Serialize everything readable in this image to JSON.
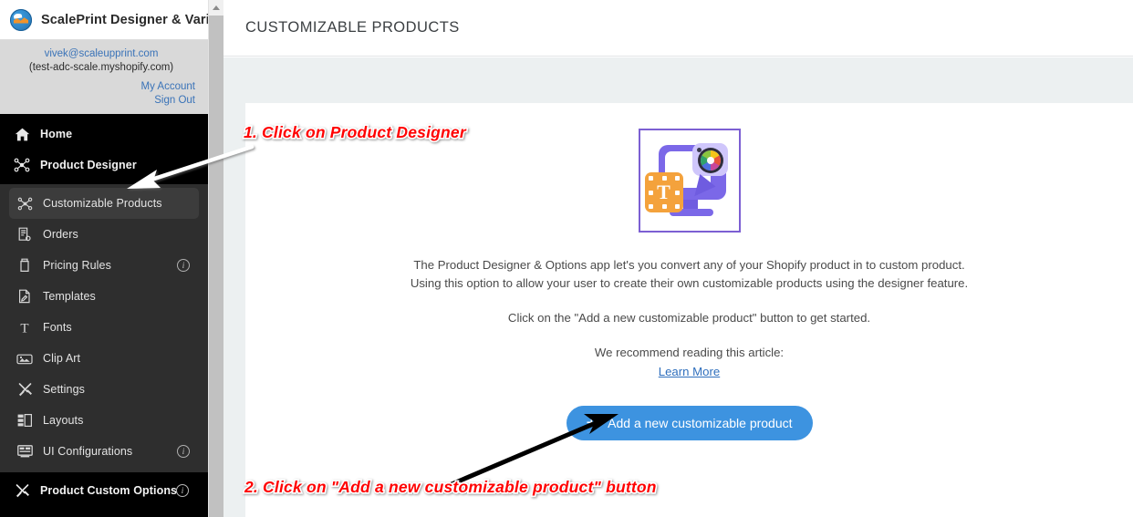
{
  "sidebar": {
    "brand": {
      "title": "ScalePrint Designer & Variants",
      "logo_icon": "scaleprint-logo-icon"
    },
    "account": {
      "email": "vivek@scaleupprint.com",
      "shop": "(test-adc-scale.myshopify.com)",
      "my_account": "My Account",
      "sign_out": "Sign Out"
    },
    "top_items": [
      {
        "label": "Home",
        "icon": "home-icon"
      },
      {
        "label": "Product Designer",
        "icon": "product-designer-icon"
      }
    ],
    "sub_items": [
      {
        "label": "Customizable Products",
        "icon": "product-designer-icon",
        "active": true,
        "info": false
      },
      {
        "label": "Orders",
        "icon": "orders-icon",
        "active": false,
        "info": false
      },
      {
        "label": "Pricing Rules",
        "icon": "pricing-icon",
        "active": false,
        "info": true
      },
      {
        "label": "Templates",
        "icon": "templates-icon",
        "active": false,
        "info": false
      },
      {
        "label": "Fonts",
        "icon": "fonts-icon",
        "active": false,
        "info": false
      },
      {
        "label": "Clip Art",
        "icon": "clipart-icon",
        "active": false,
        "info": false
      },
      {
        "label": "Settings",
        "icon": "settings-icon",
        "active": false,
        "info": false
      },
      {
        "label": "Layouts",
        "icon": "layouts-icon",
        "active": false,
        "info": false
      },
      {
        "label": "UI Configurations",
        "icon": "ui-config-icon",
        "active": false,
        "info": true
      }
    ],
    "bottom_items": [
      {
        "label": "Product Custom Options",
        "icon": "settings-icon",
        "info": true
      }
    ],
    "info_glyph": "i"
  },
  "header": {
    "title": "CUSTOMIZABLE PRODUCTS"
  },
  "main": {
    "illustration_icon": "product-designer-illustration",
    "description_line_1": "The Product Designer & Options app let's you convert any of your Shopify product in to custom product.",
    "description_line_2": "Using this option to allow your user to create their own customizable products using the designer feature.",
    "cta_text": "Click on the \"Add a new customizable product\" button to get started.",
    "recommend_text": "We recommend reading this article:",
    "learn_more": "Learn More",
    "add_button": {
      "label": "Add a new customizable product",
      "plus": "+",
      "color": "#3d93e0"
    }
  },
  "annotations": [
    {
      "text": "1. Click on Product Designer",
      "color": "#ff0000",
      "arrow": "white-arrow-to-product-designer"
    },
    {
      "text": "2. Click on \"Add a new customizable product\" button",
      "color": "#ff0000",
      "arrow": "black-arrow-to-add-button"
    }
  ],
  "scrollbar": {
    "up_arrow_icon": "scroll-up-arrow-icon",
    "thumb_color": "#c1c1c1"
  }
}
